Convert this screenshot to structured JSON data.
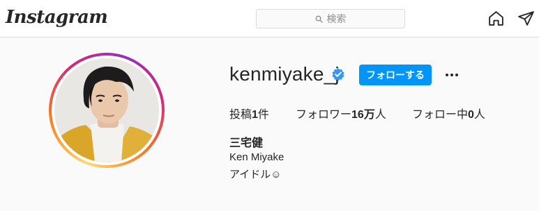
{
  "header": {
    "logo_text": "Instagram",
    "search_placeholder": "検索",
    "icons": [
      "search-icon",
      "home-icon",
      "direct-message-icon"
    ]
  },
  "profile": {
    "username": "kenmiyake_j",
    "verified": true,
    "follow_label": "フォローする",
    "stats": {
      "posts_label": "投稿",
      "posts_count": "1",
      "posts_suffix": "件",
      "followers_label": "フォロワー",
      "followers_count": "16万",
      "followers_suffix": "人",
      "following_label": "フォロー中",
      "following_count": "0",
      "following_suffix": "人"
    },
    "full_name": "三宅健",
    "bio": [
      "Ken Miyake",
      "アイドル☺"
    ]
  },
  "colors": {
    "accent": "#0095f6",
    "text": "#262626",
    "muted": "#8e8e8e",
    "background": "#fafafa",
    "verified_badge": "#3897f0"
  }
}
